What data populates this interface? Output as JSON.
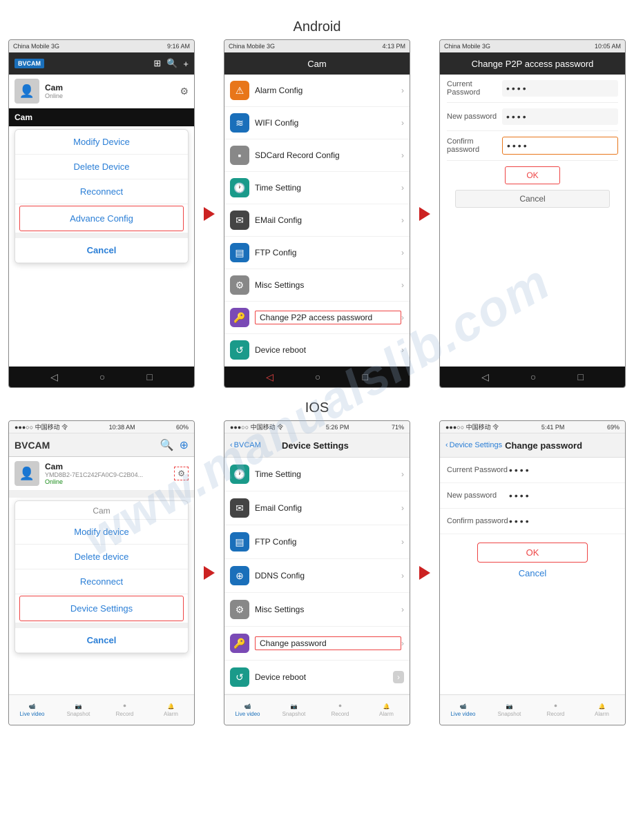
{
  "page": {
    "watermark": "www.manualslib.com"
  },
  "android_section": {
    "label": "Android",
    "phone1": {
      "status_bar": {
        "carrier": "China Mobile 3G",
        "time": "9:16 AM",
        "icons": "⊙ ≋ ▲ ▮▮▮▮"
      },
      "header": {
        "logo": "BVCAM",
        "title": ""
      },
      "cam_row": {
        "name": "Cam",
        "sub": "Online"
      },
      "context_menu": {
        "title": "Cam",
        "items": [
          "Modify Device",
          "Delete Device",
          "Reconnect",
          "Advance Config"
        ],
        "highlighted_item": "Advance Config",
        "cancel": "Cancel"
      }
    },
    "phone2": {
      "status_bar": {
        "carrier": "China Mobile 3G",
        "time": "4:13 PM"
      },
      "header": {
        "title": "Cam"
      },
      "settings_items": [
        {
          "icon_type": "orange",
          "icon": "⚠",
          "label": "Alarm Config"
        },
        {
          "icon_type": "blue",
          "icon": "≋",
          "label": "WIFI Config"
        },
        {
          "icon_type": "gray",
          "icon": "▪",
          "label": "SDCard Record Config"
        },
        {
          "icon_type": "teal",
          "icon": "🕐",
          "label": "Time Setting"
        },
        {
          "icon_type": "dark",
          "icon": "✉",
          "label": "EMail Config"
        },
        {
          "icon_type": "blue",
          "icon": "▤",
          "label": "FTP Config"
        },
        {
          "icon_type": "gray",
          "icon": "⚙",
          "label": "Misc Settings"
        },
        {
          "icon_type": "purple",
          "icon": "🔑",
          "label": "Change P2P access password",
          "highlighted": true
        },
        {
          "icon_type": "teal",
          "icon": "↺",
          "label": "Device reboot"
        }
      ]
    },
    "phone3": {
      "status_bar": {
        "carrier": "China Mobile 3G",
        "time": "10:05 AM"
      },
      "header_title": "Change P2P access password",
      "form": {
        "current_password_label": "Current Password",
        "current_password_value": "••••",
        "new_password_label": "New password",
        "new_password_value": "••••",
        "confirm_password_label": "Confirm password",
        "confirm_password_value": "••••",
        "ok_btn": "OK",
        "cancel_btn": "Cancel"
      }
    }
  },
  "ios_section": {
    "label": "IOS",
    "phone1": {
      "status_bar": {
        "carrier": "●●●○○ 中国移动 令",
        "time": "10:38 AM",
        "battery": "60%"
      },
      "header": {
        "title": "BVCAM"
      },
      "cam_row": {
        "name": "Cam",
        "sub": "YMD8B2-7E1C242FA0C9-C2B04...",
        "online": "Online"
      },
      "context_menu": {
        "title": "Cam",
        "items": [
          "Modify device",
          "Delete device",
          "Reconnect",
          "Device Settings"
        ],
        "highlighted_item": "Device Settings",
        "cancel": "Cancel"
      }
    },
    "phone2": {
      "status_bar": {
        "carrier": "●●●○○ 中国移动 令",
        "time": "5:26 PM",
        "battery": "71%"
      },
      "nav": {
        "back_label": "BVCAM",
        "title": "Device Settings"
      },
      "settings_items": [
        {
          "icon_type": "teal",
          "icon": "🕐",
          "label": "Time Setting"
        },
        {
          "icon_type": "dark",
          "icon": "✉",
          "label": "Email Config"
        },
        {
          "icon_type": "blue",
          "icon": "▤",
          "label": "FTP Config"
        },
        {
          "icon_type": "blue",
          "icon": "⊕",
          "label": "DDNS Config"
        },
        {
          "icon_type": "gray",
          "icon": "⚙",
          "label": "Misc Settings"
        },
        {
          "icon_type": "purple",
          "icon": "🔑",
          "label": "Change password",
          "highlighted": true
        },
        {
          "icon_type": "teal",
          "icon": "↺",
          "label": "Device reboot"
        }
      ]
    },
    "phone3": {
      "status_bar": {
        "carrier": "●●●○○ 中国移动 令",
        "time": "5:41 PM",
        "battery": "69%"
      },
      "nav": {
        "back_label": "Device Settings",
        "title": "Change password"
      },
      "form": {
        "current_password_label": "Current Password",
        "current_password_value": "••••",
        "new_password_label": "New password",
        "new_password_value": "••••",
        "confirm_password_label": "Confirm password",
        "confirm_password_value": "••••",
        "ok_btn": "OK",
        "cancel_btn": "Cancel"
      }
    }
  },
  "tab_bar": {
    "items": [
      "Live video",
      "Snapshot",
      "Record",
      "Alarm"
    ],
    "active_index": 0,
    "icons": [
      "📹",
      "📷",
      "⏺",
      "🔔"
    ]
  }
}
